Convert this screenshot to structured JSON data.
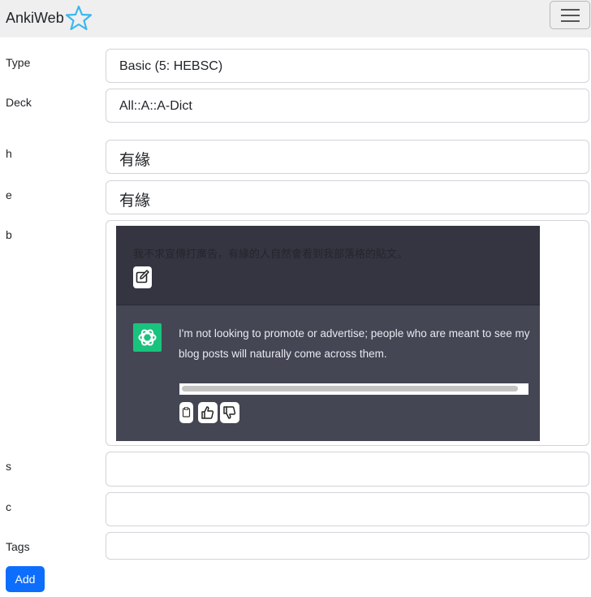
{
  "app": {
    "brand": "AnkiWeb"
  },
  "form": {
    "type_label": "Type",
    "type_value": "Basic (5: HEBSC)",
    "deck_label": "Deck",
    "deck_value": "All::A::A-Dict",
    "h_label": "h",
    "h_value": "有緣",
    "e_label": "e",
    "e_value": "有緣",
    "b_label": "b",
    "s_label": "s",
    "c_label": "c",
    "tags_label": "Tags",
    "add_label": "Add"
  },
  "chat": {
    "user_message": "我不求宣傳打廣告，有緣的人自然會看到我部落格的貼文。",
    "assistant_message": "I'm not looking to promote or advertise; people who are meant to see my blog posts will naturally come across them."
  },
  "colors": {
    "navbar_bg": "#efefef",
    "brand_star": "#3ab8ef",
    "add_button": "#0d6efd",
    "chat_user_bg": "#343541",
    "chat_ai_bg": "#444654",
    "gpt_logo": "#19c37d"
  }
}
